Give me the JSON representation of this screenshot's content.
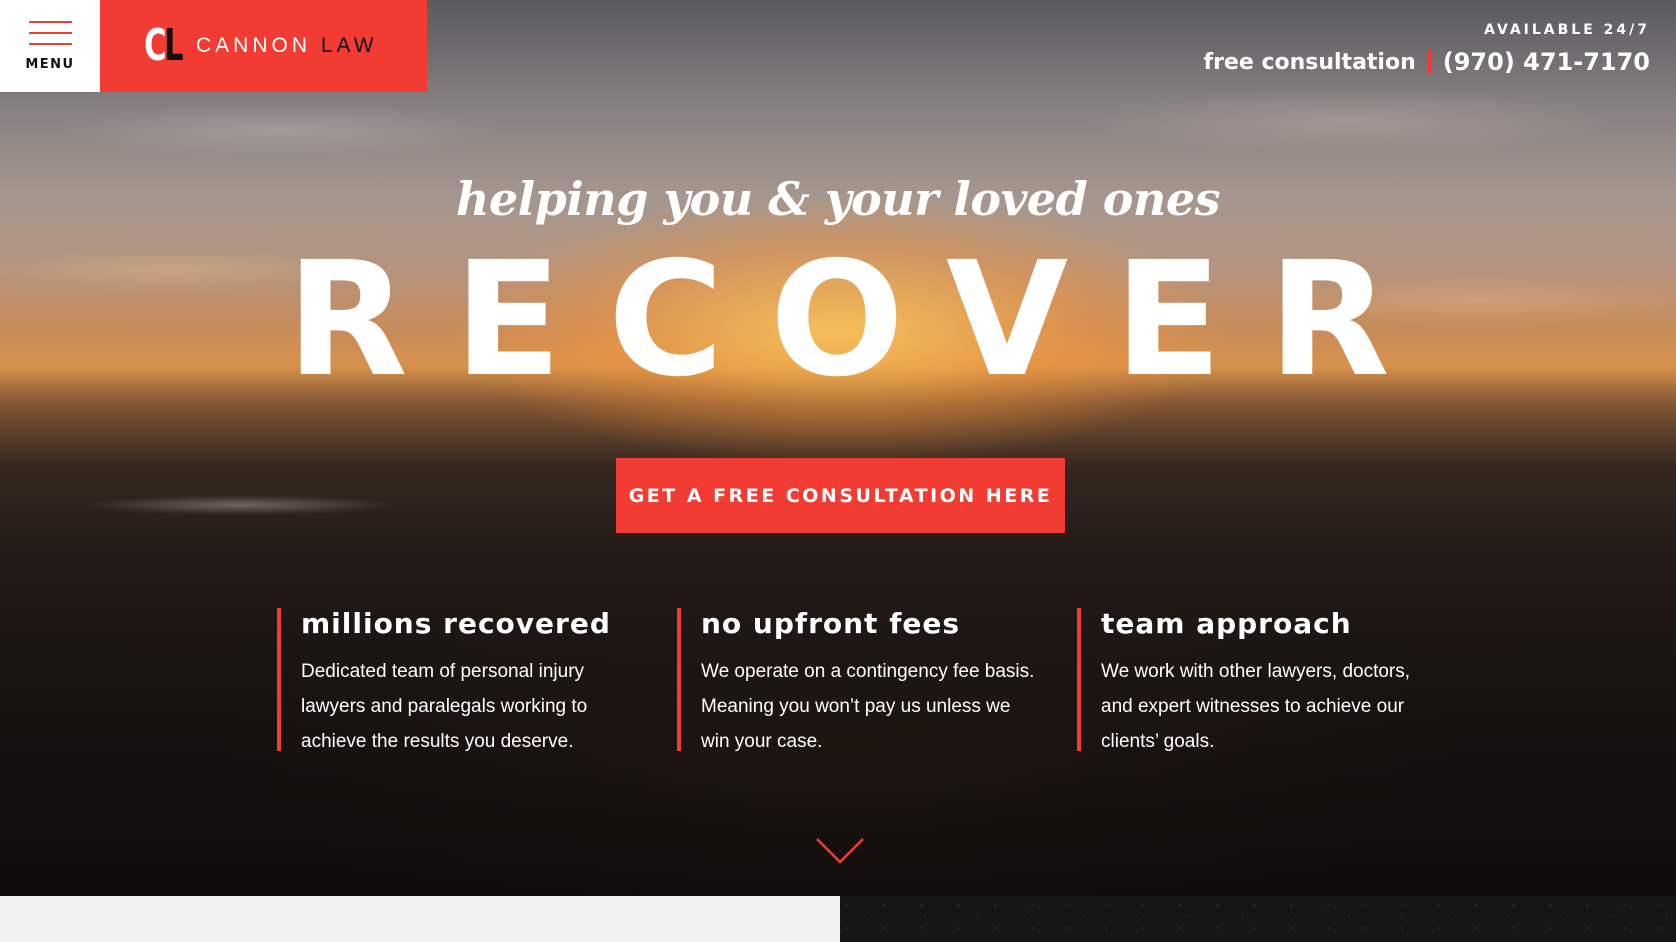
{
  "brand": {
    "logo_letter_c": "C",
    "logo_letter_l": "L",
    "name_first": "CANNON",
    "name_second": "LAW",
    "accent_color": "#f23b32"
  },
  "menu": {
    "label": "MENU",
    "icon": "hamburger-icon"
  },
  "contact": {
    "availability": "AVAILABLE 24/7",
    "consult_label": "free consultation",
    "phone": "(970) 471-7170"
  },
  "hero": {
    "tagline": "helping you & your loved ones",
    "headline": "RECOVER",
    "cta_label": "GET A FREE CONSULTATION HERE"
  },
  "features": [
    {
      "title": "millions recovered",
      "text": "Dedicated team of personal injury lawyers and paralegals working to achieve the results you deserve."
    },
    {
      "title": "no upfront fees",
      "text": "We operate on a contingency fee basis. Meaning you won’t pay us unless we win your case."
    },
    {
      "title": "team approach",
      "text": "We work with other lawyers, doctors, and expert witnesses to achieve our clients’ goals."
    }
  ],
  "scroll": {
    "icon": "chevron-down-icon"
  }
}
